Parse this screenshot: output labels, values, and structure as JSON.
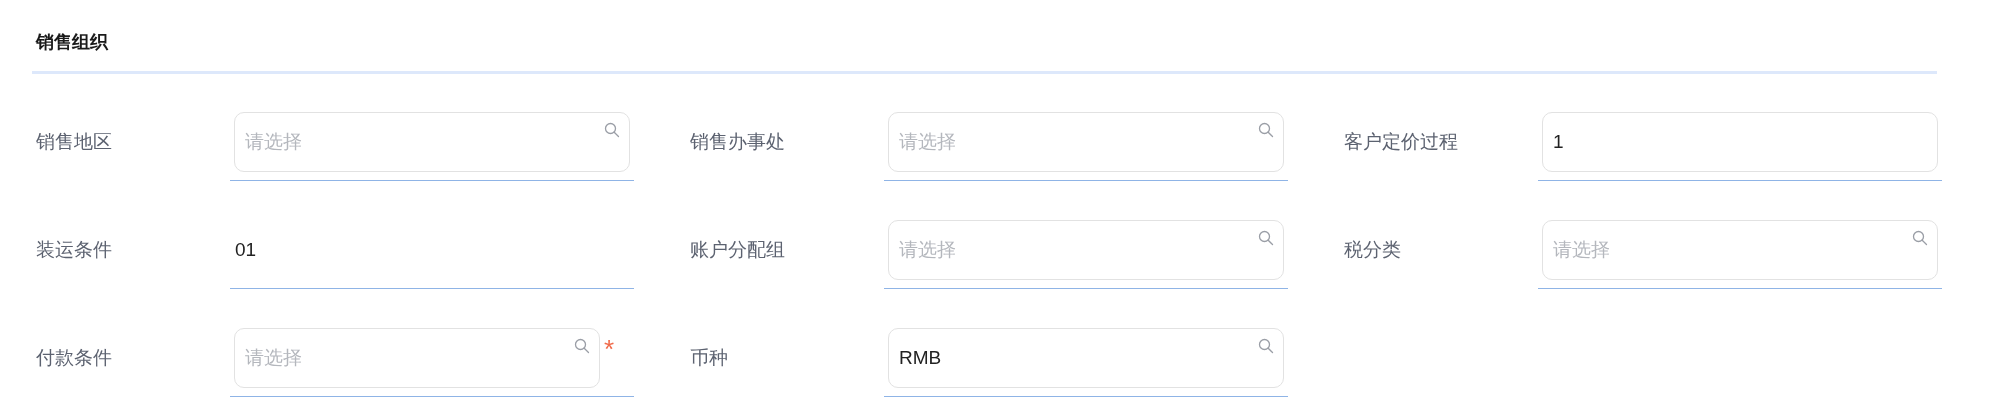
{
  "section": {
    "title": "销售组织"
  },
  "fields": [
    {
      "label": "销售地区",
      "kind": "select",
      "placeholder": "请选择"
    },
    {
      "label": "销售办事处",
      "kind": "select",
      "placeholder": "请选择"
    },
    {
      "label": "客户定价过程",
      "kind": "text",
      "value": "1"
    },
    {
      "label": "装运条件",
      "kind": "plain",
      "value": "01"
    },
    {
      "label": "账户分配组",
      "kind": "select",
      "placeholder": "请选择"
    },
    {
      "label": "税分类",
      "kind": "select",
      "placeholder": "请选择"
    },
    {
      "label": "付款条件",
      "kind": "select",
      "placeholder": "请选择",
      "required_mark": "*"
    },
    {
      "label": "币种",
      "kind": "select",
      "value": "RMB"
    }
  ]
}
